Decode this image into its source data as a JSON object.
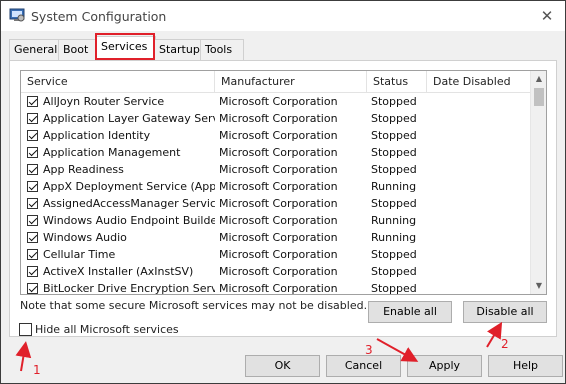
{
  "window": {
    "title": "System Configuration",
    "close_glyph": "✕"
  },
  "tabs": [
    "General",
    "Boot",
    "Services",
    "Startup",
    "Tools"
  ],
  "active_tab": "Services",
  "columns": {
    "service": "Service",
    "manufacturer": "Manufacturer",
    "status": "Status",
    "date_disabled": "Date Disabled"
  },
  "services": [
    {
      "name": "AllJoyn Router Service",
      "manufacturer": "Microsoft Corporation",
      "status": "Stopped",
      "checked": true
    },
    {
      "name": "Application Layer Gateway Service",
      "manufacturer": "Microsoft Corporation",
      "status": "Stopped",
      "checked": true
    },
    {
      "name": "Application Identity",
      "manufacturer": "Microsoft Corporation",
      "status": "Stopped",
      "checked": true
    },
    {
      "name": "Application Management",
      "manufacturer": "Microsoft Corporation",
      "status": "Stopped",
      "checked": true
    },
    {
      "name": "App Readiness",
      "manufacturer": "Microsoft Corporation",
      "status": "Stopped",
      "checked": true
    },
    {
      "name": "AppX Deployment Service (AppX...",
      "manufacturer": "Microsoft Corporation",
      "status": "Running",
      "checked": true
    },
    {
      "name": "AssignedAccessManager Service",
      "manufacturer": "Microsoft Corporation",
      "status": "Stopped",
      "checked": true
    },
    {
      "name": "Windows Audio Endpoint Builder",
      "manufacturer": "Microsoft Corporation",
      "status": "Running",
      "checked": true
    },
    {
      "name": "Windows Audio",
      "manufacturer": "Microsoft Corporation",
      "status": "Running",
      "checked": true
    },
    {
      "name": "Cellular Time",
      "manufacturer": "Microsoft Corporation",
      "status": "Stopped",
      "checked": true
    },
    {
      "name": "ActiveX Installer (AxInstSV)",
      "manufacturer": "Microsoft Corporation",
      "status": "Stopped",
      "checked": true
    },
    {
      "name": "BitLocker Drive Encryption Service",
      "manufacturer": "Microsoft Corporation",
      "status": "Stopped",
      "checked": true
    }
  ],
  "note": "Note that some secure Microsoft services may not be disabled.",
  "buttons": {
    "enable_all": "Enable all",
    "disable_all": "Disable all",
    "ok": "OK",
    "cancel": "Cancel",
    "apply": "Apply",
    "help": "Help"
  },
  "hide_ms": {
    "label": "Hide all Microsoft services",
    "checked": false
  },
  "annotations": {
    "one": "1",
    "two": "2",
    "three": "3"
  },
  "colors": {
    "annotation": "#e0202a",
    "highlight": "#e0202a"
  },
  "icons": {
    "app": "system-config-icon",
    "close": "close-icon",
    "scroll_up": "scroll-up-icon",
    "scroll_down": "scroll-down-icon"
  }
}
